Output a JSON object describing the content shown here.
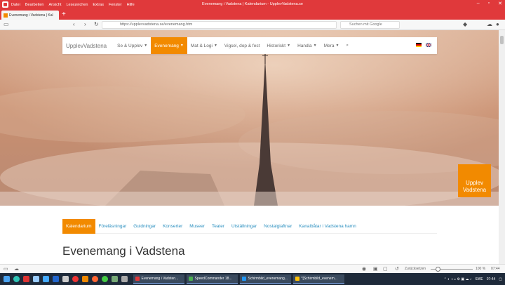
{
  "window": {
    "title": "Evenemang i Vadstena | Kalendarium - UpplevVadstena.se",
    "menu": [
      "Datei",
      "Bearbeiten",
      "Ansicht",
      "Lesezeichen",
      "Extras",
      "Fenster",
      "Hilfe"
    ]
  },
  "tab": {
    "label": "Evenemang i Vadstena | Kal"
  },
  "address": {
    "url": "https://upplevvadstena.se/evenemang.htm",
    "search_placeholder": "Suchen mit Google"
  },
  "site": {
    "brand": "UpplevVadstena",
    "nav": [
      {
        "label": "Se & Upplev",
        "dropdown": true,
        "active": false
      },
      {
        "label": "Evenemang",
        "dropdown": true,
        "active": true
      },
      {
        "label": "Mat & Logi",
        "dropdown": true,
        "active": false
      },
      {
        "label": "Vigsel, dop & fest",
        "dropdown": false,
        "active": false
      },
      {
        "label": "Historiskt",
        "dropdown": true,
        "active": false
      },
      {
        "label": "Handla",
        "dropdown": true,
        "active": false
      },
      {
        "label": "Mera",
        "dropdown": true,
        "active": false
      }
    ],
    "badge_line1": "Upplev",
    "badge_line2": "Vadstena",
    "subnav": [
      "Kalendarium",
      "Föreläsningar",
      "Guidningar",
      "Konserter",
      "Museer",
      "Teater",
      "Utställningar",
      "Nostalgiaftnar",
      "Kanalbåtar i Vadstena hamn"
    ],
    "heading": "Evenemang i Vadstena"
  },
  "statusbar": {
    "zoom_label": "Zurücksetzen",
    "zoom": "100 %",
    "time": "07:44"
  },
  "taskbar": {
    "apps": [
      {
        "label": "Evenemang i Vadsten...",
        "color": "#e0393b"
      },
      {
        "label": "SpeedCommander 18...",
        "color": "#4caf50"
      },
      {
        "label": "Schirmbild_evenemang...",
        "color": "#2196f3"
      },
      {
        "label": "*[Schirmbild_evenem...",
        "color": "#ffc107"
      }
    ],
    "lang": "SWE",
    "time": "07:44"
  },
  "colors": {
    "accent": "#f28a00",
    "browser": "#e0393b",
    "link": "#2a8fbf"
  }
}
